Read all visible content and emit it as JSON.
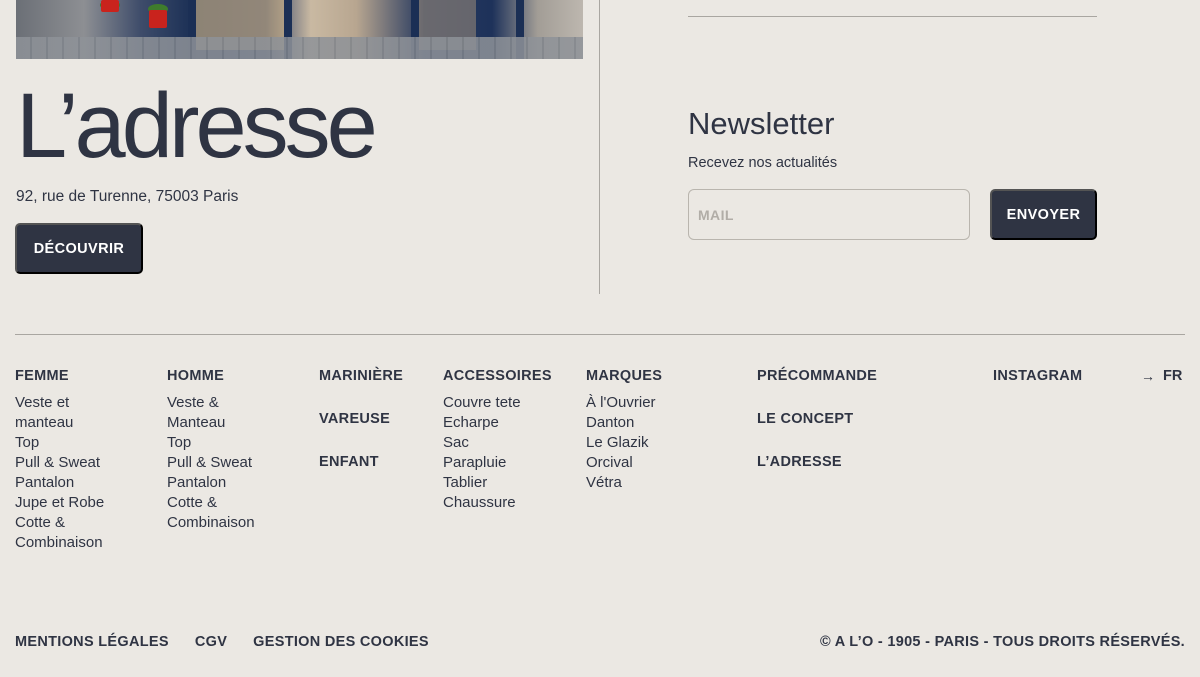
{
  "store": {
    "title": "L’adresse",
    "address": "92, rue de Turenne, 75003 Paris",
    "cta_label": "DÉCOUVRIR"
  },
  "newsletter": {
    "title": "Newsletter",
    "subtitle": "Recevez nos actualités",
    "placeholder": "MAIL",
    "value": "",
    "submit_label": "ENVOYER"
  },
  "footer_nav": {
    "femme": {
      "heading": "FEMME",
      "items": [
        "Veste et manteau",
        "Top",
        "Pull & Sweat",
        "Pantalon",
        "Jupe et Robe",
        "Cotte & Combinaison"
      ]
    },
    "homme": {
      "heading": "HOMME",
      "items": [
        "Veste & Manteau",
        "Top",
        "Pull & Sweat",
        "Pantalon",
        "Cotte & Combinaison"
      ]
    },
    "col3": [
      "MARINIÈRE",
      "VAREUSE",
      "ENFANT"
    ],
    "accessoires": {
      "heading": "ACCESSOIRES",
      "items": [
        "Couvre tete",
        "Echarpe",
        "Sac",
        "Parapluie",
        "Tablier",
        "Chaussure"
      ]
    },
    "marques": {
      "heading": "MARQUES",
      "items": [
        "À l'Ouvrier",
        "Danton",
        "Le Glazik",
        "Orcival",
        "Vétra"
      ]
    },
    "col6": [
      "PRÉCOMMANDE",
      "LE CONCEPT",
      "L’ADRESSE"
    ],
    "instagram": "INSTAGRAM",
    "language": "FR"
  },
  "legal": {
    "mentions": "MENTIONS LÉGALES",
    "cgv": "CGV",
    "cookies": "GESTION DES COOKIES",
    "copyright": "© A L’O - 1905 - PARIS - TOUS DROITS RÉSERVÉS."
  },
  "colors": {
    "background": "#ebe8e3",
    "ink": "#2f3443",
    "divider": "#a9a6a1"
  }
}
